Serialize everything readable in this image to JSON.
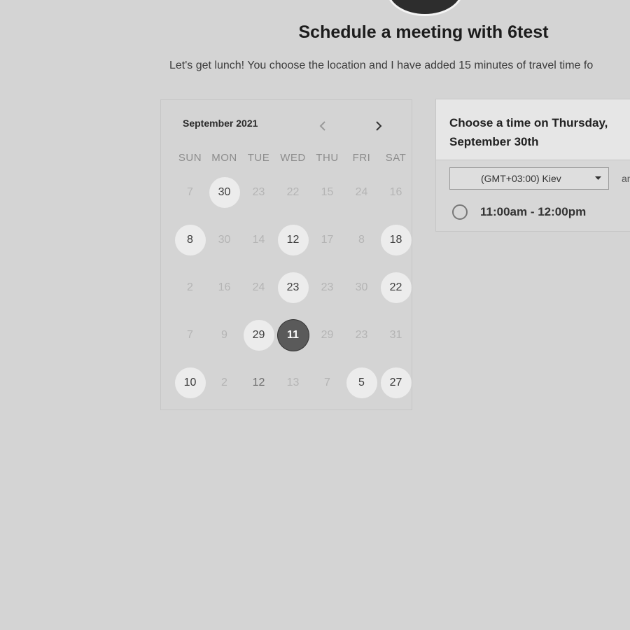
{
  "header": {
    "title": "Schedule a meeting with 6test",
    "subtitle": "Let's get lunch! You choose the location and I have added 15 minutes of travel time fo"
  },
  "calendar": {
    "month_label": "September 2021",
    "prev_icon": "chevron-left-icon",
    "next_icon": "chevron-right-icon",
    "weekdays": [
      "SUN",
      "MON",
      "TUE",
      "WED",
      "THU",
      "FRI",
      "SAT"
    ],
    "weeks": [
      [
        {
          "day": "7",
          "state": "disabled"
        },
        {
          "day": "30",
          "state": "available"
        },
        {
          "day": "23",
          "state": "disabled"
        },
        {
          "day": "22",
          "state": "disabled"
        },
        {
          "day": "15",
          "state": "disabled"
        },
        {
          "day": "24",
          "state": "disabled"
        },
        {
          "day": "16",
          "state": "disabled"
        }
      ],
      [
        {
          "day": "8",
          "state": "available"
        },
        {
          "day": "30",
          "state": "disabled"
        },
        {
          "day": "14",
          "state": "disabled"
        },
        {
          "day": "12",
          "state": "available"
        },
        {
          "day": "17",
          "state": "disabled"
        },
        {
          "day": "8",
          "state": "disabled"
        },
        {
          "day": "18",
          "state": "available"
        }
      ],
      [
        {
          "day": "2",
          "state": "disabled"
        },
        {
          "day": "16",
          "state": "disabled"
        },
        {
          "day": "24",
          "state": "disabled"
        },
        {
          "day": "23",
          "state": "available"
        },
        {
          "day": "23",
          "state": "disabled"
        },
        {
          "day": "30",
          "state": "disabled"
        },
        {
          "day": "22",
          "state": "available"
        }
      ],
      [
        {
          "day": "7",
          "state": "disabled"
        },
        {
          "day": "9",
          "state": "disabled"
        },
        {
          "day": "29",
          "state": "available"
        },
        {
          "day": "11",
          "state": "selected"
        },
        {
          "day": "29",
          "state": "disabled"
        },
        {
          "day": "23",
          "state": "disabled"
        },
        {
          "day": "31",
          "state": "disabled"
        }
      ],
      [
        {
          "day": "10",
          "state": "available"
        },
        {
          "day": "2",
          "state": "disabled"
        },
        {
          "day": "12",
          "state": "mid"
        },
        {
          "day": "13",
          "state": "disabled"
        },
        {
          "day": "7",
          "state": "disabled"
        },
        {
          "day": "5",
          "state": "available"
        },
        {
          "day": "27",
          "state": "available"
        }
      ]
    ]
  },
  "time_panel": {
    "title": "Choose a time on Thursday, September 30th",
    "timezone_value": "(GMT+03:00) Kiev",
    "timezone_caret_icon": "caret-down-icon",
    "extra_text": "an",
    "slots": [
      {
        "label": "11:00am - 12:00pm",
        "selected": false
      }
    ]
  },
  "colors": {
    "background": "#d4d4d4",
    "available_day": "#ececec",
    "selected_day": "#5a5a5a",
    "header_panel": "#e6e6e6"
  }
}
